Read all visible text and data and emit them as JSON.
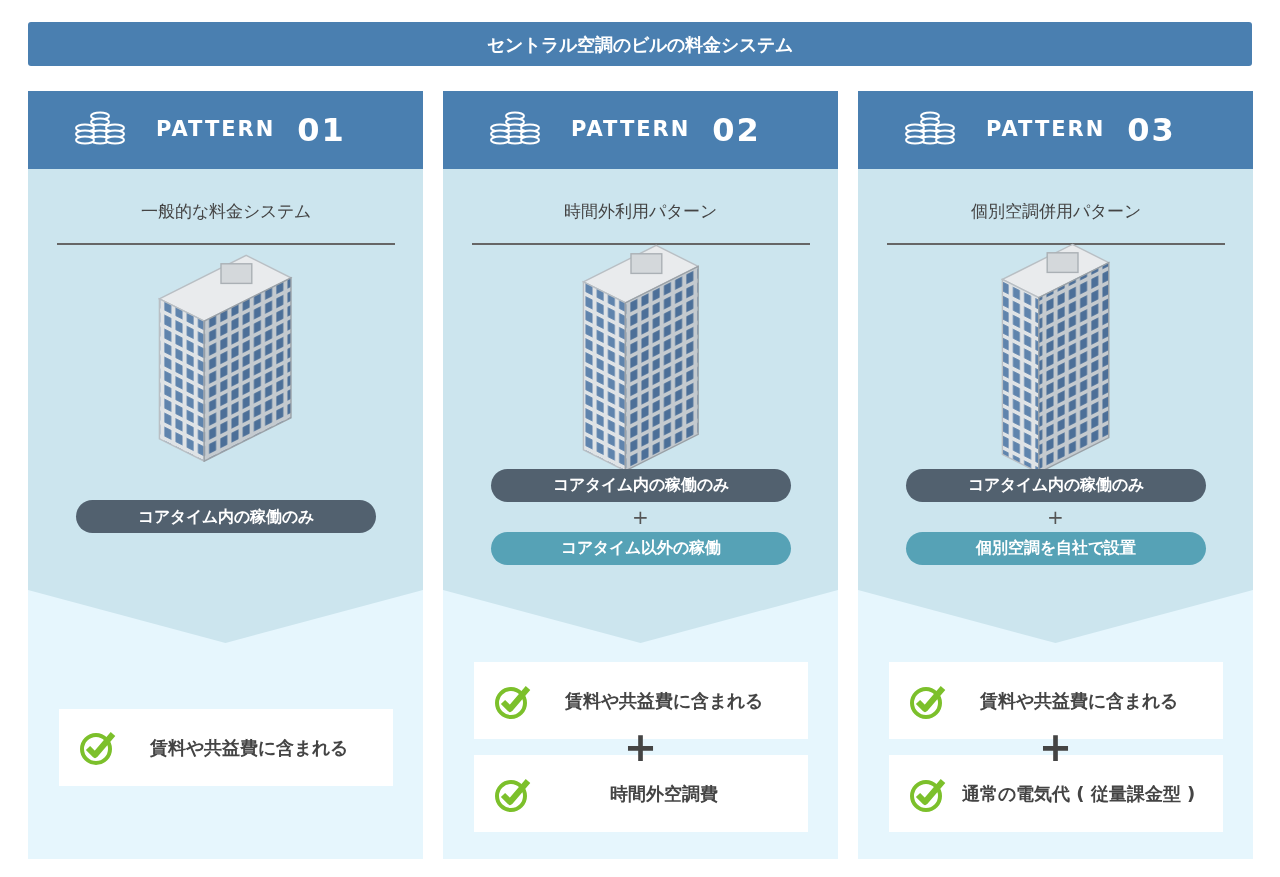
{
  "title": "セントラル空調のビルの料金システム",
  "patterns": [
    {
      "label": "PATTERN",
      "number": "01",
      "subtitle": "一般的な料金システム",
      "conditions": [
        {
          "kind": "pill",
          "text": "コアタイム内の稼働のみ",
          "color": "#52616f"
        }
      ],
      "charges": [
        {
          "kind": "item",
          "text": "賃料や共益費に含まれる"
        }
      ]
    },
    {
      "label": "PATTERN",
      "number": "02",
      "subtitle": "時間外利用パターン",
      "conditions": [
        {
          "kind": "pill",
          "text": "コアタイム内の稼働のみ",
          "color": "#52616f"
        },
        {
          "kind": "plus",
          "text": "+"
        },
        {
          "kind": "pill",
          "text": "コアタイム以外の稼働",
          "color": "#56a2b6"
        }
      ],
      "charges": [
        {
          "kind": "item",
          "text": "賃料や共益費に含まれる"
        },
        {
          "kind": "plus",
          "text": "+"
        },
        {
          "kind": "item",
          "text": "時間外空調費"
        }
      ]
    },
    {
      "label": "PATTERN",
      "number": "03",
      "subtitle": "個別空調併用パターン",
      "conditions": [
        {
          "kind": "pill",
          "text": "コアタイム内の稼働のみ",
          "color": "#52616f"
        },
        {
          "kind": "plus",
          "text": "+"
        },
        {
          "kind": "pill",
          "text": "個別空調を自社で設置",
          "color": "#56a2b6"
        }
      ],
      "charges": [
        {
          "kind": "item",
          "text": "賃料や共益費に含まれる"
        },
        {
          "kind": "plus",
          "text": "+"
        },
        {
          "kind": "item",
          "text": "通常の電気代 ( 従量課金型 )"
        }
      ]
    }
  ]
}
